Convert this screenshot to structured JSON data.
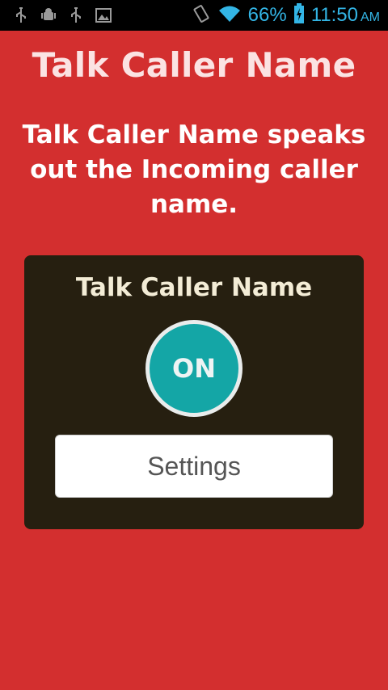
{
  "status_bar": {
    "icons_left": [
      "usb-icon",
      "android-debug-icon",
      "usb-icon",
      "image-icon"
    ],
    "icons_right": [
      "vibrate-icon",
      "wifi-icon",
      "battery-charging-icon"
    ],
    "battery_percent": "66%",
    "time": "11:50",
    "ampm": "AM",
    "accent_color": "#33b5e5"
  },
  "header": {
    "title": "Talk Caller Name",
    "description": "Talk Caller Name speaks out the Incoming caller name."
  },
  "card": {
    "title": "Talk Caller Name",
    "toggle_label": "ON",
    "toggle_color": "#14a6a6",
    "settings_label": "Settings"
  },
  "theme": {
    "background": "#d32f2f",
    "card_background": "#261f10"
  }
}
